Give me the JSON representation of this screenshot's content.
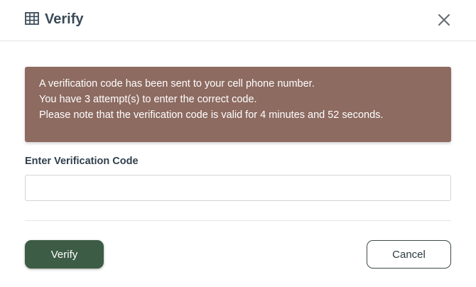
{
  "dialog": {
    "title": "Verify",
    "title_icon": "table-icon",
    "close_icon": "close-icon"
  },
  "alert": {
    "lines": [
      "A verification code has been sent to your cell phone number.",
      "You have 3 attempt(s) to enter the correct code.",
      "Please note that the verification code is valid for 4 minutes and 52 seconds."
    ],
    "background_color": "#8d6b61"
  },
  "form": {
    "code_label": "Enter Verification Code",
    "code_value": "",
    "code_placeholder": ""
  },
  "actions": {
    "verify_label": "Verify",
    "cancel_label": "Cancel",
    "verify_color": "#3d5c45"
  }
}
